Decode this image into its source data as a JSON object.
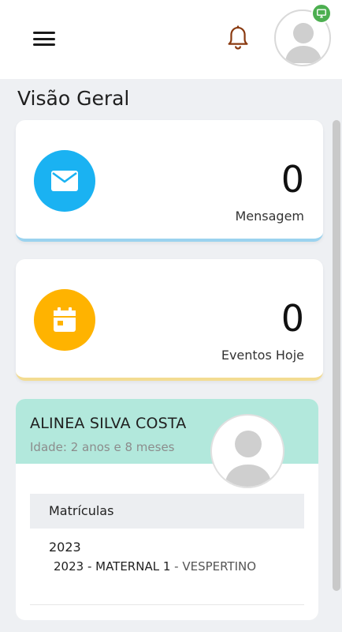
{
  "header": {
    "menu_icon": "hamburger-menu-icon",
    "notification_icon": "bell-icon",
    "profile_badge_icon": "monitor-icon",
    "colors": {
      "bell": "#8a3a10",
      "badge": "#4caf50"
    }
  },
  "page": {
    "title": "Visão Geral"
  },
  "stats": {
    "messages": {
      "count": "0",
      "label": "Mensagem",
      "icon": "envelope-icon",
      "color": "#1ab2f2"
    },
    "events": {
      "count": "0",
      "label": "Eventos Hoje",
      "icon": "calendar-icon",
      "color": "#ffb300"
    }
  },
  "student": {
    "name": "ALINEA SILVA COSTA",
    "age": "Idade: 2 anos e 8 meses",
    "header_color": "#b2e8dc",
    "enrollments_title": "Matrículas",
    "enrollments": [
      {
        "year": "2023",
        "class": "2023 - MATERNAL 1",
        "shift": " - VESPERTINO"
      }
    ]
  }
}
